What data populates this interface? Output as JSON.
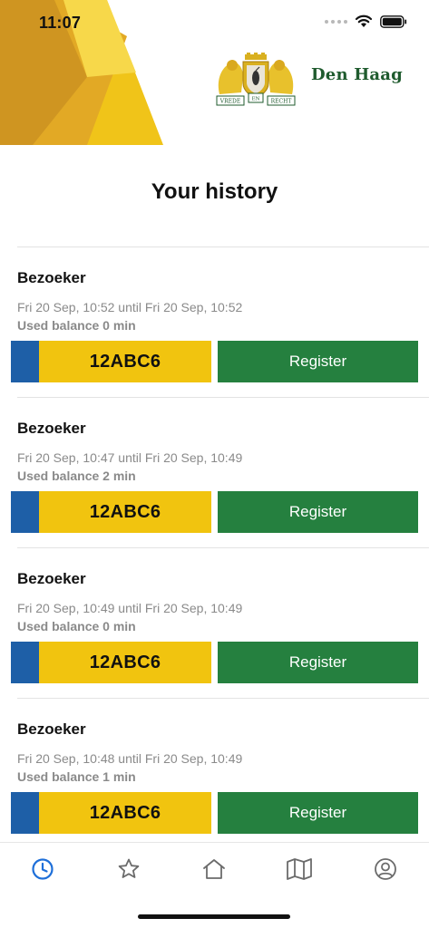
{
  "status_bar": {
    "time": "11:07"
  },
  "header": {
    "city_name": "Den Haag",
    "crest_motto_left": "VREDE",
    "crest_motto_middle": "EN",
    "crest_motto_right": "RECHT"
  },
  "page": {
    "title": "Your history"
  },
  "history": [
    {
      "type": "Bezoeker",
      "period": "Fri 20 Sep, 10:52 until Fri 20 Sep, 10:52",
      "balance": "Used balance 0 min",
      "plate": "12ABC6",
      "action": "Register"
    },
    {
      "type": "Bezoeker",
      "period": "Fri 20 Sep, 10:47 until Fri 20 Sep, 10:49",
      "balance": "Used balance 2 min",
      "plate": "12ABC6",
      "action": "Register"
    },
    {
      "type": "Bezoeker",
      "period": "Fri 20 Sep, 10:49 until Fri 20 Sep, 10:49",
      "balance": "Used balance 0 min",
      "plate": "12ABC6",
      "action": "Register"
    },
    {
      "type": "Bezoeker",
      "period": "Fri 20 Sep, 10:48 until Fri 20 Sep, 10:49",
      "balance": "Used balance 1 min",
      "plate": "12ABC6",
      "action": "Register"
    }
  ],
  "tab_bar": {
    "tabs": [
      {
        "icon": "clock-icon",
        "active": true
      },
      {
        "icon": "star-icon",
        "active": false
      },
      {
        "icon": "home-icon",
        "active": false
      },
      {
        "icon": "map-icon",
        "active": false
      },
      {
        "icon": "profile-icon",
        "active": false
      }
    ]
  },
  "colors": {
    "accent_active": "#1e6fd9",
    "icon_inactive": "#6b6b6b",
    "plate_yellow": "#f1c40f",
    "plate_blue": "#1e5fa7",
    "register_green": "#25803f",
    "brand_green": "#1f5b2e"
  }
}
